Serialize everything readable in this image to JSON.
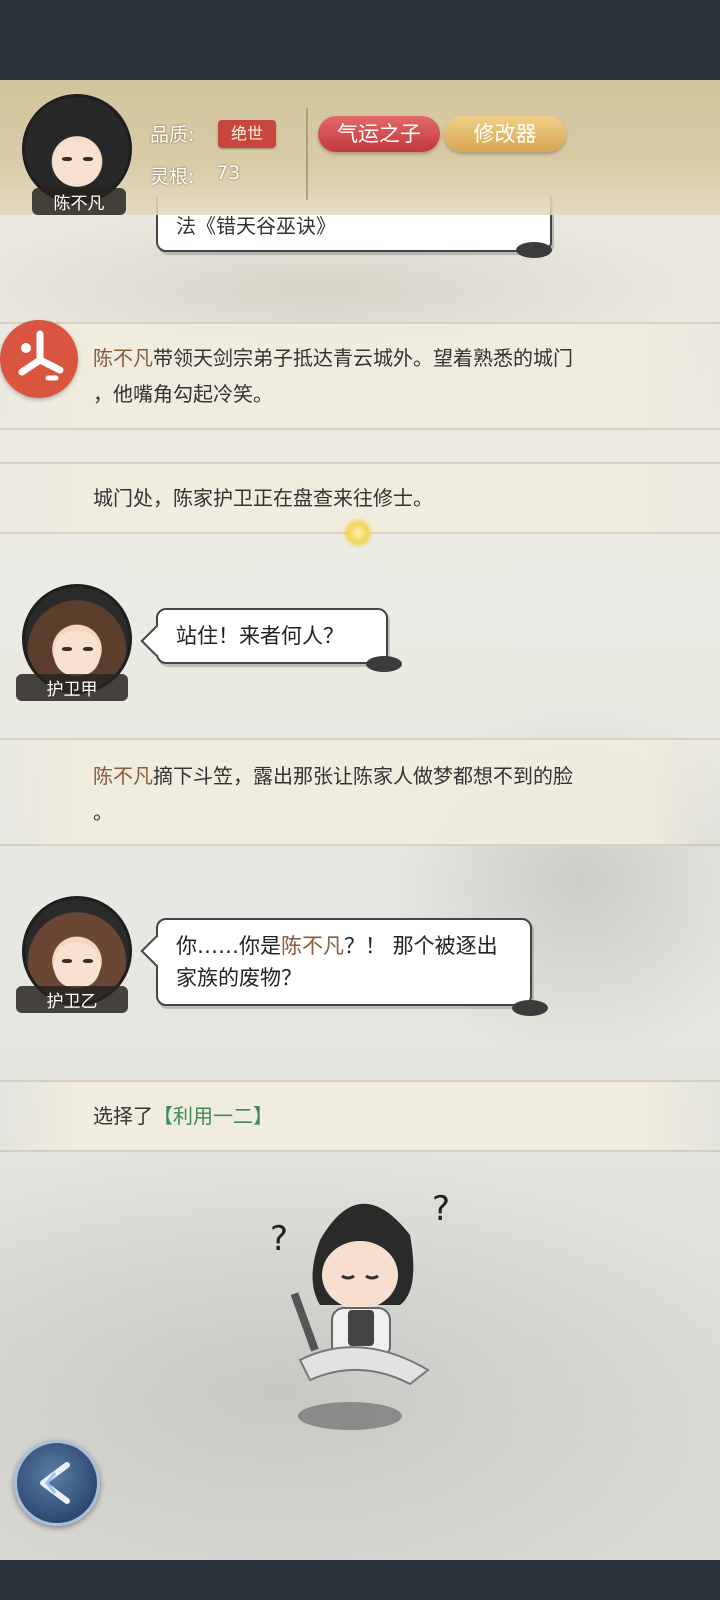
{
  "header": {
    "player_name": "陈不凡",
    "quality_label": "品质:",
    "quality_value": "绝世",
    "root_label": "灵根:",
    "root_value": "73",
    "tag_destiny": "气运之子",
    "tag_modifier": "修改器"
  },
  "story": {
    "prev_bubble_fragment": "法《错天谷巫诀》",
    "narration1_name": "陈不凡",
    "narration1_line1_rest": "带领天剑宗弟子抵达青云城外。望着熟悉的城门",
    "narration1_line2": "，他嘴角勾起冷笑。",
    "narration2": "城门处，陈家护卫正在盘查来往修士。",
    "guard_a_name": "护卫甲",
    "guard_a_line": "站住！来者何人？",
    "narration3_name": "陈不凡",
    "narration3_line1_rest": "摘下斗笠，露出那张让陈家人做梦都想不到的脸",
    "narration3_line2": "。",
    "guard_b_name": "护卫乙",
    "guard_b_pre": "你……你是",
    "guard_b_highlight": "陈不凡",
    "guard_b_post": "？！ 那个被逐出",
    "guard_b_line2": "家族的废物？",
    "choice_prefix": "选择了",
    "choice_value": "【利用一二】"
  },
  "colors": {
    "name_highlight": "#8b5a3a",
    "choice_highlight": "#3e8a5a",
    "tag_red": "#d44a4c",
    "tag_gold": "#e6bb6a"
  },
  "icons": [
    "skip-icon",
    "back-icon"
  ]
}
